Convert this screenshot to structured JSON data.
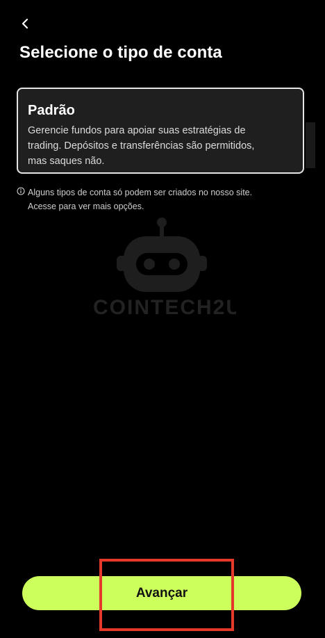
{
  "header": {
    "back_icon": "chevron-left-icon",
    "title": "Selecione o tipo de conta"
  },
  "account_option": {
    "title": "Padrão",
    "description": "Gerencie fundos para apoiar suas estratégias de trading. Depósitos e transferências são permitidos, mas saques não.",
    "selected": true
  },
  "info": {
    "icon": "info-icon",
    "text": "Alguns tipos de conta só podem ser criados no nosso site. Acesse para ver mais opções."
  },
  "watermark": {
    "brand": "COINTECH2U",
    "icon": "robot-logo-icon"
  },
  "footer": {
    "next_label": "Avançar"
  },
  "colors": {
    "background": "#000000",
    "card_background": "#1f1f1f",
    "card_border": "#e6e6e6",
    "accent": "#ccff5c",
    "highlight": "#e53a2b"
  }
}
